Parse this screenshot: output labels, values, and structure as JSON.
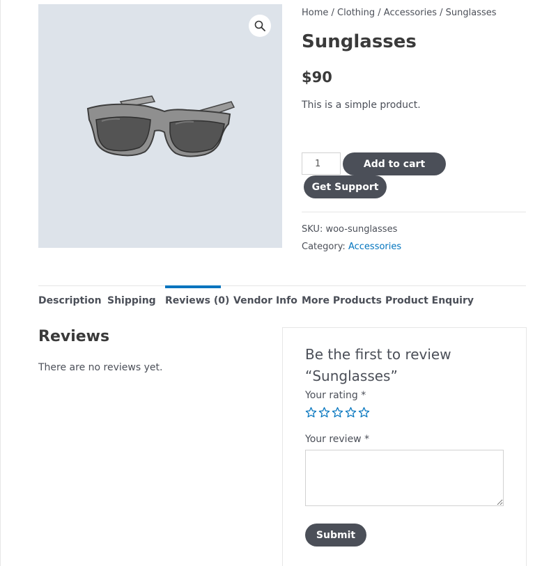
{
  "breadcrumb": {
    "home": "Home",
    "clothing": "Clothing",
    "accessories": "Accessories",
    "current": "Sunglasses",
    "separator": " / "
  },
  "product": {
    "title": "Sunglasses",
    "price": "$90",
    "short_description": "This is a simple product.",
    "quantity": "1",
    "add_to_cart_label": "Add to cart",
    "get_support_label": "Get Support",
    "sku_label": "SKU:",
    "sku_value": "woo-sunglasses",
    "category_label": "Category:",
    "category_value": "Accessories",
    "zoom_icon": "magnifier-icon"
  },
  "tabs": [
    {
      "label": "Description",
      "active": false
    },
    {
      "label": "Shipping",
      "active": false
    },
    {
      "label": "Reviews (0)",
      "active": true
    },
    {
      "label": "Vendor Info",
      "active": false
    },
    {
      "label": "More Products",
      "active": false
    },
    {
      "label": "Product Enquiry",
      "active": false
    }
  ],
  "reviews": {
    "heading": "Reviews",
    "empty_text": "There are no reviews yet.",
    "reply_title": "Be the first to review “Sunglasses”",
    "rating_label": "Your rating",
    "review_label": "Your review",
    "required_mark": "*",
    "stars": [
      "1",
      "2",
      "3",
      "4",
      "5"
    ],
    "submit_label": "Submit"
  },
  "colors": {
    "button": "#4b4f58",
    "link": "#0274be",
    "image_bg": "#dde3ea"
  }
}
